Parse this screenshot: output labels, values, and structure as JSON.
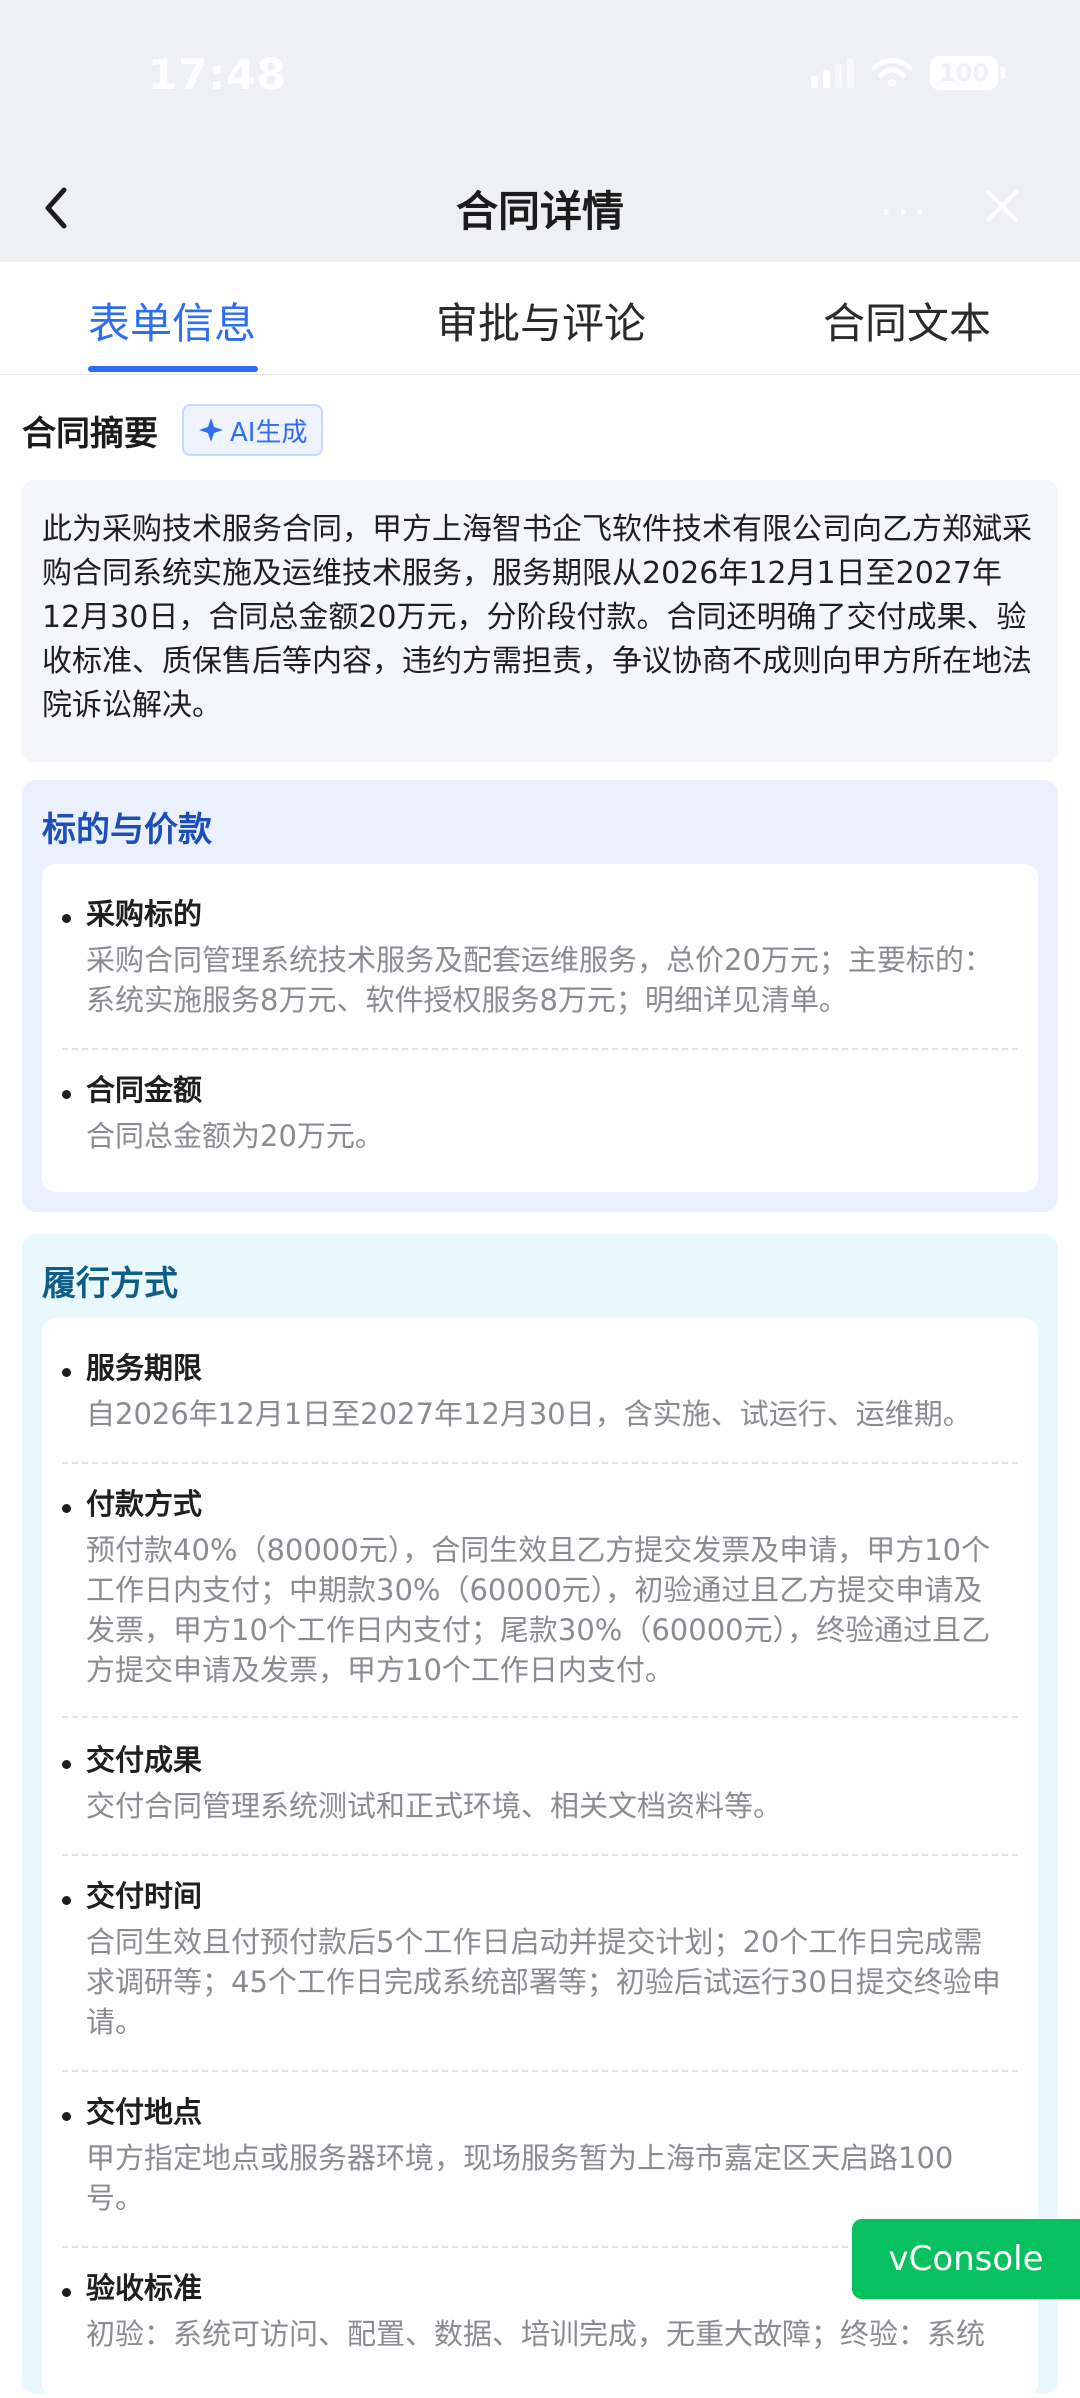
{
  "status": {
    "time": "17:48",
    "battery": "100"
  },
  "nav": {
    "title": "合同详情",
    "more": "···"
  },
  "tabs": [
    {
      "label": "表单信息",
      "active": true
    },
    {
      "label": "审批与评论",
      "active": false
    },
    {
      "label": "合同文本",
      "active": false
    }
  ],
  "summary": {
    "title": "合同摘要",
    "ai_badge": "AI生成",
    "text": "此为采购技术服务合同，甲方上海智书企飞软件技术有限公司向乙方郑斌采购合同系统实施及运维技术服务，服务期限从2026年12月1日至2027年12月30日，合同总金额20万元，分阶段付款。合同还明确了交付成果、验收标准、质保售后等内容，违约方需担责，争议协商不成则向甲方所在地法院诉讼解决。"
  },
  "sections": [
    {
      "title": "标的与价款",
      "items": [
        {
          "name": "采购标的",
          "desc": "采购合同管理系统技术服务及配套运维服务，总价20万元；主要标的：系统实施服务8万元、软件授权服务8万元；明细详见清单。"
        },
        {
          "name": "合同金额",
          "desc": "合同总金额为20万元。"
        }
      ]
    },
    {
      "title": "履行方式",
      "items": [
        {
          "name": "服务期限",
          "desc": "自2026年12月1日至2027年12月30日，含实施、试运行、运维期。"
        },
        {
          "name": "付款方式",
          "desc": "预付款40%（80000元），合同生效且乙方提交发票及申请，甲方10个工作日内支付；中期款30%（60000元），初验通过且乙方提交申请及发票，甲方10个工作日内支付；尾款30%（60000元），终验通过且乙方提交申请及发票，甲方10个工作日内支付。"
        },
        {
          "name": "交付成果",
          "desc": "交付合同管理系统测试和正式环境、相关文档资料等。"
        },
        {
          "name": "交付时间",
          "desc": "合同生效且付预付款后5个工作日启动并提交计划；20个工作日完成需求调研等；45个工作日完成系统部署等；初验后试运行30日提交终验申请。"
        },
        {
          "name": "交付地点",
          "desc": "甲方指定地点或服务器环境，现场服务暂为上海市嘉定区天启路100号。"
        },
        {
          "name": "验收标准",
          "desc": "初验：系统可访问、配置、数据、培训完成，无重大故障；终验：系统"
        }
      ]
    }
  ],
  "vconsole": "vConsole",
  "colors": {
    "accent": "#2f6ef2",
    "vconsole": "#07c160"
  }
}
